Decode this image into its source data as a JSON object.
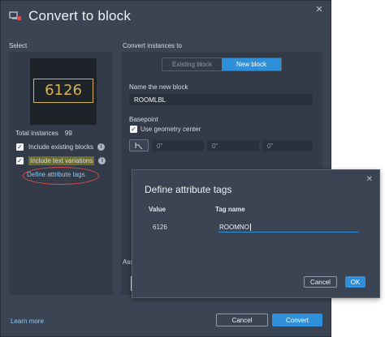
{
  "dialog": {
    "title": "Convert to block",
    "close_glyph": "✕"
  },
  "select": {
    "label": "Select",
    "preview_value": "6126",
    "total_label": "Total instances",
    "total_count": "99",
    "include_existing_label": "Include existing blocks",
    "include_existing_checked": true,
    "include_text_label": "Include text variations",
    "include_text_checked": true,
    "define_tags_link": "Define attribute tags"
  },
  "convert": {
    "label": "Convert instances to",
    "tabs": [
      {
        "label": "Existing block",
        "active": false
      },
      {
        "label": "New block",
        "active": true
      }
    ],
    "name_label": "Name the new block",
    "name_value": "ROOMLBL",
    "basepoint_label": "Basepoint",
    "use_geometry_label": "Use geometry center",
    "use_geometry_checked": true,
    "coords": [
      "0\"",
      "0\"",
      "0\""
    ],
    "truncated_assoc_label": "Ass"
  },
  "footer": {
    "learn_more": "Learn more",
    "cancel": "Cancel",
    "convert": "Convert"
  },
  "attr_dialog": {
    "title": "Define attribute tags",
    "value_header": "Value",
    "tag_header": "Tag name",
    "value": "6126",
    "tag_value": "ROOMNO",
    "cancel": "Cancel",
    "ok": "OK"
  },
  "colors": {
    "dialog_bg": "#3b4453",
    "panel_bg": "#333b48",
    "accent": "#2f8fd8",
    "preview_text": "#d8b54a",
    "annotation": "#e24a4a",
    "link": "#8ec7f2"
  },
  "icons": {
    "title": "convert-block-icon",
    "info": "info-icon",
    "pick_point": "pick-point-icon",
    "close": "close-icon"
  }
}
